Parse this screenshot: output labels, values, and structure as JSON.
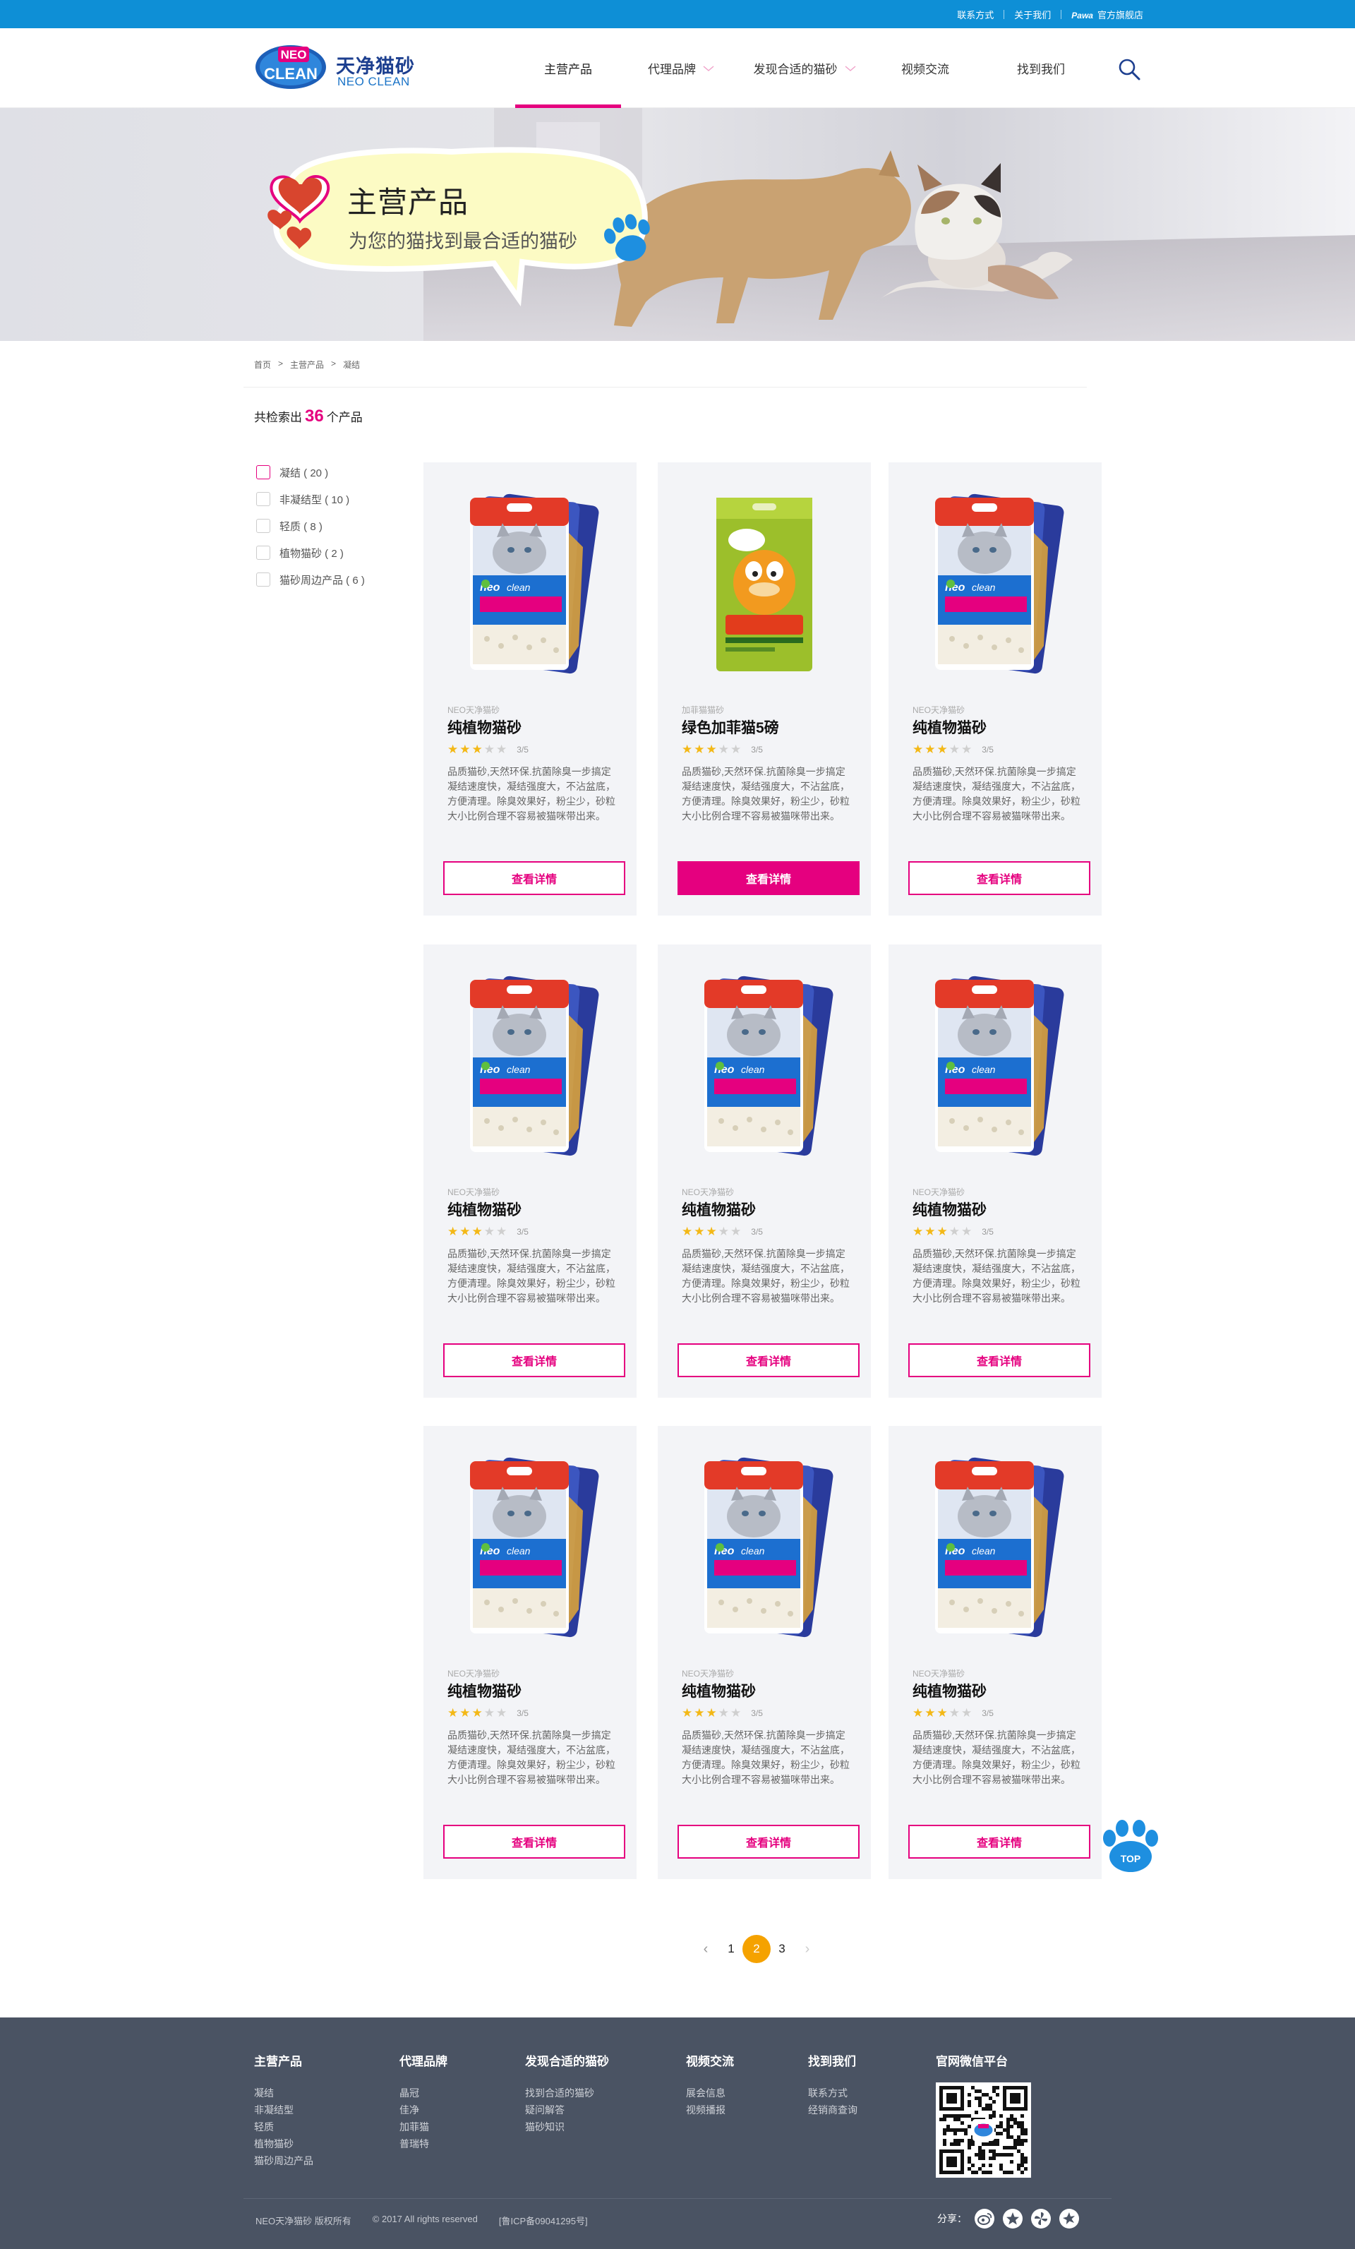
{
  "topbar": {
    "links": [
      "联系方式",
      "关于我们",
      "官方旗舰店"
    ],
    "store_logo": "Pawa"
  },
  "header": {
    "logo_badge_top": "NEO",
    "logo_badge_bottom": "CLEAN",
    "logo_cn": "天净猫砂",
    "logo_en": "NEO CLEAN",
    "nav": [
      {
        "label": "主营产品",
        "active": true,
        "dropdown": false
      },
      {
        "label": "代理品牌",
        "active": false,
        "dropdown": true
      },
      {
        "label": "发现合适的猫砂",
        "active": false,
        "dropdown": true
      },
      {
        "label": "视频交流",
        "active": false,
        "dropdown": false
      },
      {
        "label": "找到我们",
        "active": false,
        "dropdown": false
      }
    ],
    "search_icon": "search-icon"
  },
  "banner": {
    "title": "主营产品",
    "subtitle": "为您的猫找到最合适的猫砂"
  },
  "breadcrumb": [
    "首页",
    ">",
    "主营产品",
    ">",
    "凝结"
  ],
  "results": {
    "prefix": "共检索出",
    "count": "36",
    "suffix": "个产品"
  },
  "filters": [
    {
      "label": "凝结 ( 20 )",
      "checked": true
    },
    {
      "label": "非凝结型 ( 10 )",
      "checked": false
    },
    {
      "label": "轻质 ( 8 )",
      "checked": false
    },
    {
      "label": "植物猫砂 ( 2 )",
      "checked": false
    },
    {
      "label": "猫砂周边产品 ( 6 )",
      "checked": false
    }
  ],
  "products": [
    {
      "brand": "NEO天净猫砂",
      "name": "纯植物猫砂",
      "rating": 3,
      "rating_text": "3/5",
      "desc": "品质猫砂,天然环保.抗菌除臭一步搞定凝结速度快，凝结强度大，不沾盆底，方便清理。除臭效果好，粉尘少，砂粒大小比例合理不容易被猫咪带出来。",
      "button": "查看详情",
      "button_style": "outline",
      "package": "neo"
    },
    {
      "brand": "加菲猫猫砂",
      "name": "绿色加菲猫5磅",
      "rating": 3,
      "rating_text": "3/5",
      "desc": "品质猫砂,天然环保.抗菌除臭一步搞定凝结速度快，凝结强度大，不沾盆底，方便清理。除臭效果好，粉尘少，砂粒大小比例合理不容易被猫咪带出来。",
      "button": "查看详情",
      "button_style": "filled",
      "package": "garfield"
    },
    {
      "brand": "NEO天净猫砂",
      "name": "纯植物猫砂",
      "rating": 3,
      "rating_text": "3/5",
      "desc": "品质猫砂,天然环保.抗菌除臭一步搞定凝结速度快，凝结强度大，不沾盆底，方便清理。除臭效果好，粉尘少，砂粒大小比例合理不容易被猫咪带出来。",
      "button": "查看详情",
      "button_style": "outline",
      "package": "neo"
    },
    {
      "brand": "NEO天净猫砂",
      "name": "纯植物猫砂",
      "rating": 3,
      "rating_text": "3/5",
      "desc": "品质猫砂,天然环保.抗菌除臭一步搞定凝结速度快，凝结强度大，不沾盆底，方便清理。除臭效果好，粉尘少，砂粒大小比例合理不容易被猫咪带出来。",
      "button": "查看详情",
      "button_style": "outline",
      "package": "neo"
    },
    {
      "brand": "NEO天净猫砂",
      "name": "纯植物猫砂",
      "rating": 3,
      "rating_text": "3/5",
      "desc": "品质猫砂,天然环保.抗菌除臭一步搞定凝结速度快，凝结强度大，不沾盆底，方便清理。除臭效果好，粉尘少，砂粒大小比例合理不容易被猫咪带出来。",
      "button": "查看详情",
      "button_style": "outline",
      "package": "neo"
    },
    {
      "brand": "NEO天净猫砂",
      "name": "纯植物猫砂",
      "rating": 3,
      "rating_text": "3/5",
      "desc": "品质猫砂,天然环保.抗菌除臭一步搞定凝结速度快，凝结强度大，不沾盆底，方便清理。除臭效果好，粉尘少，砂粒大小比例合理不容易被猫咪带出来。",
      "button": "查看详情",
      "button_style": "outline",
      "package": "neo"
    },
    {
      "brand": "NEO天净猫砂",
      "name": "纯植物猫砂",
      "rating": 3,
      "rating_text": "3/5",
      "desc": "品质猫砂,天然环保.抗菌除臭一步搞定凝结速度快，凝结强度大，不沾盆底，方便清理。除臭效果好，粉尘少，砂粒大小比例合理不容易被猫咪带出来。",
      "button": "查看详情",
      "button_style": "outline",
      "package": "neo"
    },
    {
      "brand": "NEO天净猫砂",
      "name": "纯植物猫砂",
      "rating": 3,
      "rating_text": "3/5",
      "desc": "品质猫砂,天然环保.抗菌除臭一步搞定凝结速度快，凝结强度大，不沾盆底，方便清理。除臭效果好，粉尘少，砂粒大小比例合理不容易被猫咪带出来。",
      "button": "查看详情",
      "button_style": "outline",
      "package": "neo"
    },
    {
      "brand": "NEO天净猫砂",
      "name": "纯植物猫砂",
      "rating": 3,
      "rating_text": "3/5",
      "desc": "品质猫砂,天然环保.抗菌除臭一步搞定凝结速度快，凝结强度大，不沾盆底，方便清理。除臭效果好，粉尘少，砂粒大小比例合理不容易被猫咪带出来。",
      "button": "查看详情",
      "button_style": "outline",
      "package": "neo"
    }
  ],
  "to_top": "TOP",
  "pagination": {
    "prev": "‹",
    "pages": [
      "1",
      "2",
      "3"
    ],
    "current": "2",
    "next": "›"
  },
  "footer": {
    "columns": [
      {
        "title": "主营产品",
        "links": [
          "凝结",
          "非凝结型",
          "轻质",
          "植物猫砂",
          "猫砂周边产品"
        ]
      },
      {
        "title": "代理品牌",
        "links": [
          "晶冠",
          "佳净",
          "加菲猫",
          "普瑞特"
        ]
      },
      {
        "title": "发现合适的猫砂",
        "links": [
          "找到合适的猫砂",
          "疑问解答",
          "猫砂知识"
        ]
      },
      {
        "title": "视频交流",
        "links": [
          "展会信息",
          "视频播报"
        ]
      },
      {
        "title": "找到我们",
        "links": [
          "联系方式",
          "经销商查询"
        ]
      },
      {
        "title": "官网微信平台",
        "links": []
      }
    ],
    "copyright": [
      "NEO天净猫砂  版权所有",
      "© 2017 All rights reserved",
      "[鲁ICP备09041295号]"
    ],
    "share_label": "分享：",
    "share_icons": [
      "weibo-icon",
      "qzone-icon",
      "pinwheel-icon",
      "flower-icon"
    ],
    "accent": "#e5007f",
    "topbar_color": "#0e8fd6",
    "footer_color": "#4a5363"
  }
}
